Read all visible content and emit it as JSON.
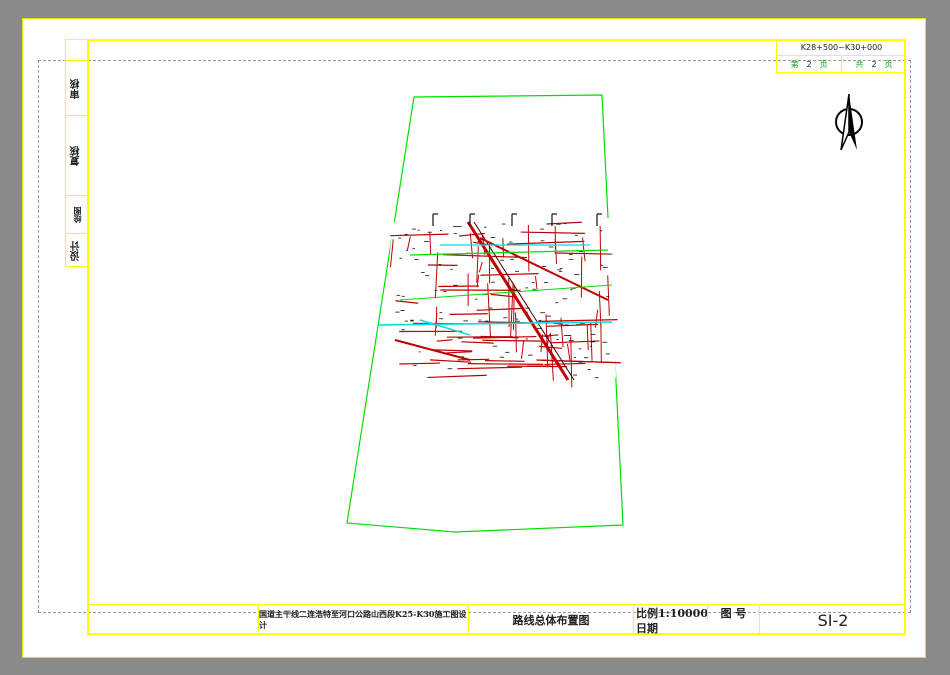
{
  "drawing": {
    "left_strip": {
      "review": "审核",
      "recheck": "复核",
      "draw": "绘图",
      "design": "设计"
    },
    "sheet_range": "K28+500~K30+000",
    "sheet_current_label": "第",
    "sheet_current": "2",
    "sheet_current_unit": "页",
    "sheet_total_label": "共",
    "sheet_total": "2",
    "sheet_total_unit": "页",
    "project_name": "国道主干线二连浩特至河口公路山西段K25-K30施工图设计",
    "drawing_name": "路线总体布置图",
    "scale": "比例1:10000",
    "figure_no_label": "图 号",
    "date_label": "日期",
    "drawing_no": "SI-2"
  },
  "colors": {
    "frame": "#ffff00",
    "outline": "#00e000",
    "road": "#c00000",
    "route": "#00e0e0",
    "background": "#8a8a8a"
  },
  "icons": [
    "north-arrow-icon"
  ]
}
